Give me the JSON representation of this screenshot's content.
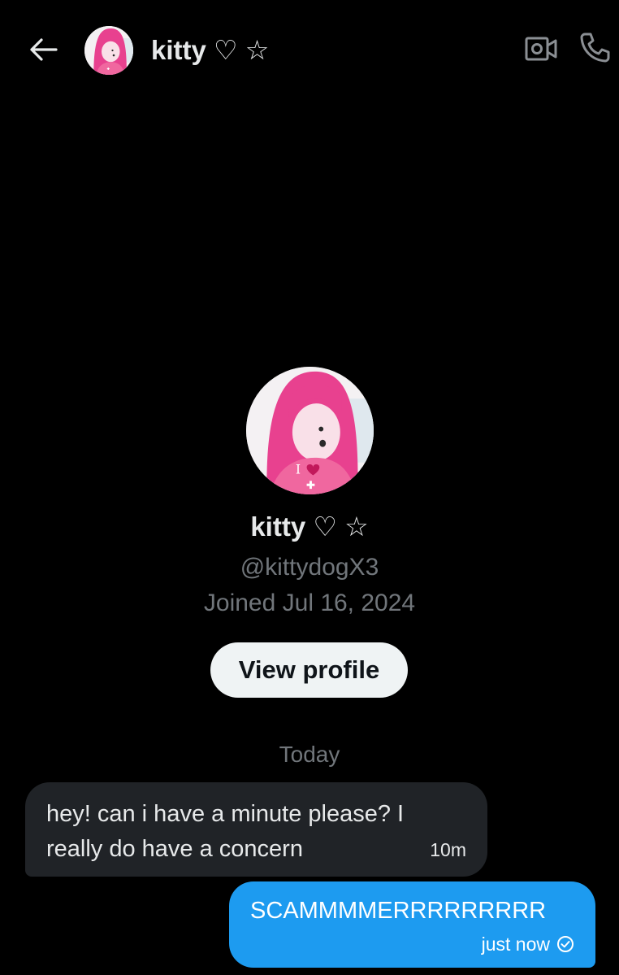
{
  "header": {
    "back_icon": "back-arrow-icon",
    "name": "kitty",
    "name_symbols": "♡ ☆",
    "video_icon": "video-call-icon",
    "call_icon": "phone-icon"
  },
  "profile": {
    "name": "kitty",
    "name_symbols": "♡ ☆",
    "handle": "@kittydogX3",
    "joined": "Joined Jul 16, 2024",
    "view_profile_label": "View profile",
    "avatar_shirt_text": "I"
  },
  "conversation": {
    "day_separator": "Today",
    "messages": [
      {
        "direction": "incoming",
        "text": "hey! can i have a minute please? I really do have a concern",
        "time": "10m"
      },
      {
        "direction": "outgoing",
        "text": "SCAMMMMERRRRRRRRR",
        "time": "just now",
        "status_icon": "sent-check-icon"
      }
    ]
  },
  "colors": {
    "background": "#000000",
    "primary_text": "#e7e9ea",
    "secondary_text": "#71767b",
    "incoming_bubble": "#202327",
    "outgoing_bubble": "#1d9bf0",
    "button_bg": "#eff3f4",
    "avatar_hair": "#e8418f"
  }
}
